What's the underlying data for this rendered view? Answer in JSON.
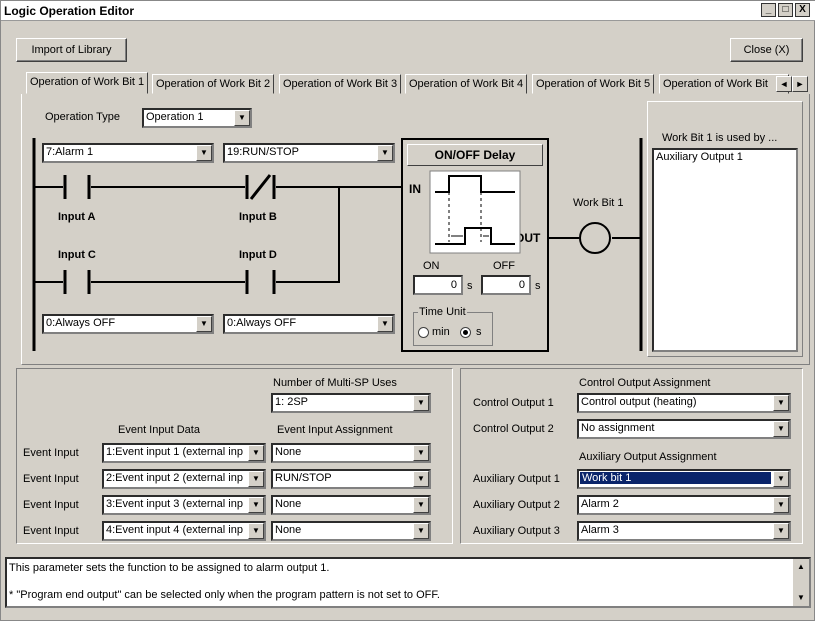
{
  "window": {
    "title": "Logic Operation Editor",
    "min": "_",
    "max": "□",
    "close": "X"
  },
  "toolbar": {
    "import": "Import of Library",
    "close": "Close (X)"
  },
  "tabs": [
    "Operation of Work Bit 1",
    "Operation of Work Bit 2",
    "Operation of Work Bit 3",
    "Operation of Work Bit 4",
    "Operation of Work Bit 5",
    "Operation of Work Bit"
  ],
  "tab_arrows": {
    "left": "◄",
    "right": "►"
  },
  "operation": {
    "type_label": "Operation Type",
    "type_value": "Operation 1"
  },
  "inputs": {
    "a_select": "7:Alarm 1",
    "b_select": "19:RUN/STOP",
    "c_select": "0:Always OFF",
    "d_select": "0:Always OFF",
    "a_label": "Input A",
    "b_label": "Input B",
    "c_label": "Input C",
    "d_label": "Input D"
  },
  "delay": {
    "title": "ON/OFF Delay",
    "in": "IN",
    "out": "OUT",
    "on_label": "ON",
    "off_label": "OFF",
    "on_value": "0",
    "off_value": "0",
    "unit_s": "s",
    "time_unit": "Time Unit",
    "opt_min": "min",
    "opt_s": "s"
  },
  "workbit": {
    "label": "Work Bit 1",
    "used_by_title": "Work Bit 1 is used by ...",
    "used_by": [
      "Auxiliary Output 1"
    ]
  },
  "event": {
    "num_sp_label": "Number of Multi-SP Uses",
    "num_sp_value": "1: 2SP",
    "data_header": "Event Input Data",
    "assign_header": "Event Input Assignment",
    "rows": [
      {
        "label": "Event Input",
        "data": "1:Event input 1 (external inp",
        "assign": "None"
      },
      {
        "label": "Event Input",
        "data": "2:Event input 2 (external inp",
        "assign": "RUN/STOP"
      },
      {
        "label": "Event Input",
        "data": "3:Event input 3 (external inp",
        "assign": "None"
      },
      {
        "label": "Event Input",
        "data": "4:Event input 4 (external inp",
        "assign": "None"
      }
    ]
  },
  "outputs": {
    "control_header": "Control Output Assignment",
    "control": [
      {
        "label": "Control Output 1",
        "value": "Control output (heating)"
      },
      {
        "label": "Control Output 2",
        "value": "No assignment"
      }
    ],
    "aux_header": "Auxiliary Output Assignment",
    "aux": [
      {
        "label": "Auxiliary Output 1",
        "value": "Work bit 1"
      },
      {
        "label": "Auxiliary Output 2",
        "value": "Alarm 2"
      },
      {
        "label": "Auxiliary Output 3",
        "value": "Alarm 3"
      }
    ]
  },
  "help": {
    "line1": "This parameter sets the function to be assigned to alarm output 1.",
    "line2": "* \"Program end output\" can be selected only when the program pattern is not set to OFF."
  },
  "icons": {
    "dropdown": "▼",
    "scroll_up": "▲",
    "scroll_down": "▼"
  }
}
